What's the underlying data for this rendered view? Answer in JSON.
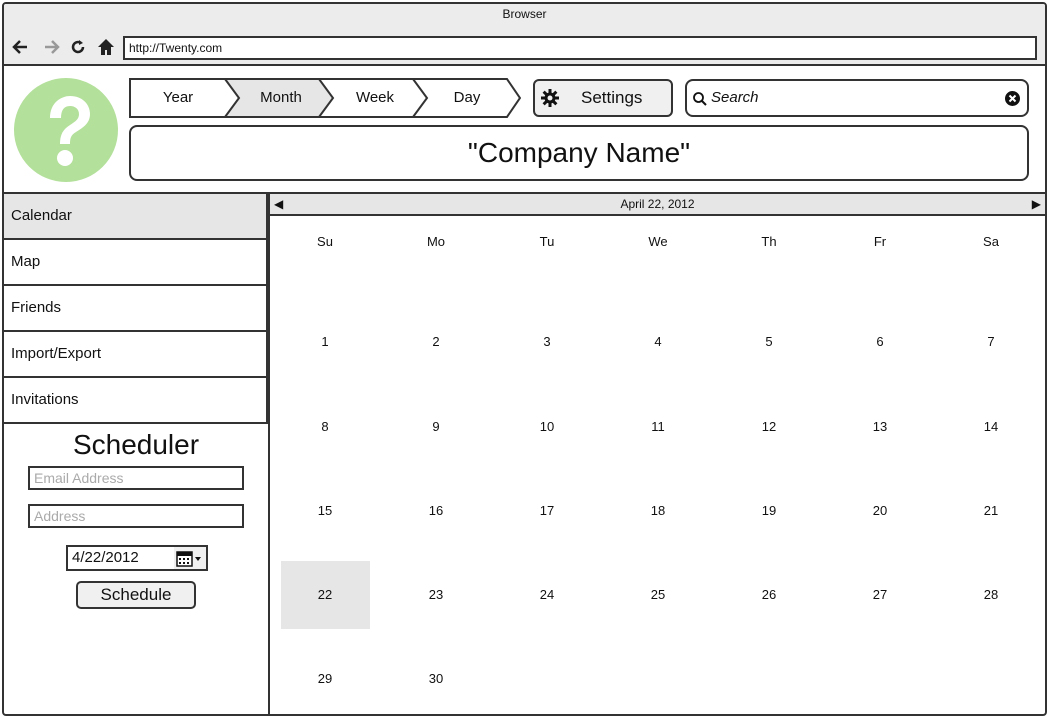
{
  "browser": {
    "title": "Browser",
    "url": "http://Twenty.com",
    "icons": [
      "back-arrow-icon",
      "forward-arrow-icon",
      "reload-icon",
      "home-icon"
    ]
  },
  "header": {
    "logo_icon": "question-mark-icon",
    "tabs": [
      "Year",
      "Month",
      "Week",
      "Day"
    ],
    "active_tab": "Month",
    "settings_label": "Settings",
    "search_placeholder": "Search",
    "company_name": "\"Company Name\""
  },
  "sidebar": {
    "items": [
      "Calendar",
      "Map",
      "Friends",
      "Import/Export",
      "Invitations"
    ],
    "active_item": "Calendar"
  },
  "scheduler": {
    "title": "Scheduler",
    "email_placeholder": "Email Address",
    "address_placeholder": "Address",
    "date_value": "4/22/2012",
    "button_label": "Schedule"
  },
  "calendar": {
    "header_date": "April 22, 2012",
    "prev_symbol": "◀",
    "next_symbol": "▶",
    "weekdays": [
      "Su",
      "Mo",
      "Tu",
      "We",
      "Th",
      "Fr",
      "Sa"
    ],
    "weeks": [
      [
        "1",
        "2",
        "3",
        "4",
        "5",
        "6",
        "7"
      ],
      [
        "8",
        "9",
        "10",
        "11",
        "12",
        "13",
        "14"
      ],
      [
        "15",
        "16",
        "17",
        "18",
        "19",
        "20",
        "21"
      ],
      [
        "22",
        "23",
        "24",
        "25",
        "26",
        "27",
        "28"
      ],
      [
        "29",
        "30"
      ]
    ],
    "selected_day": "22"
  },
  "colors": {
    "logo": "#b3e09a",
    "active_bg": "#e6e6e6",
    "border": "#333333"
  }
}
